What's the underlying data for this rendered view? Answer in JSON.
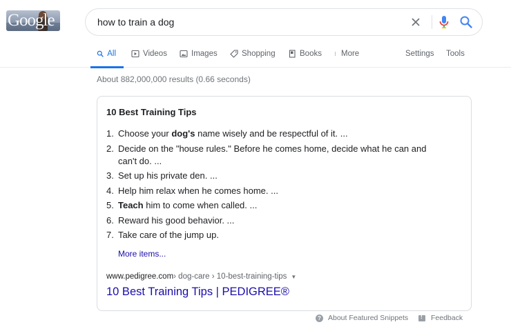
{
  "search": {
    "query": "how to train a dog"
  },
  "tabs": [
    {
      "label": "All",
      "icon": "search-icon",
      "active": true
    },
    {
      "label": "Videos",
      "icon": "play-icon"
    },
    {
      "label": "Images",
      "icon": "image-icon"
    },
    {
      "label": "Shopping",
      "icon": "tag-icon"
    },
    {
      "label": "Books",
      "icon": "book-icon"
    },
    {
      "label": "More",
      "icon": "more-vertical-icon"
    }
  ],
  "tools": {
    "settings": "Settings",
    "tools": "Tools"
  },
  "result_stats": "About 882,000,000 results (0.66 seconds)",
  "snippet": {
    "title": "10 Best Training Tips",
    "items": [
      {
        "num": "1.",
        "parts": [
          {
            "t": "Choose your "
          },
          {
            "t": "dog's",
            "b": true
          },
          {
            "t": " name wisely and be respectful of it. ..."
          }
        ]
      },
      {
        "num": "2.",
        "parts": [
          {
            "t": "Decide on the \"house rules.\" Before he comes home, decide what he can and can't do. ..."
          }
        ]
      },
      {
        "num": "3.",
        "parts": [
          {
            "t": "Set up his private den. ..."
          }
        ]
      },
      {
        "num": "4.",
        "parts": [
          {
            "t": "Help him relax when he comes home. ..."
          }
        ]
      },
      {
        "num": "5.",
        "parts": [
          {
            "t": "Teach",
            "b": true
          },
          {
            "t": " him to come when called. ..."
          }
        ]
      },
      {
        "num": "6.",
        "parts": [
          {
            "t": "Reward his good behavior. ..."
          }
        ]
      },
      {
        "num": "7.",
        "parts": [
          {
            "t": "Take care of the jump up."
          }
        ]
      }
    ],
    "more_items": "More items...",
    "cite_domain": "www.pedigree.com",
    "cite_path": " › dog-care › 10-best-training-tips",
    "link_title": "10 Best Training Tips | PEDIGREE®"
  },
  "footer": {
    "about": "About Featured Snippets",
    "feedback": "Feedback"
  },
  "logo": {
    "text": "Google"
  },
  "colors": {
    "accent": "#1a73e8",
    "link": "#1a0dab",
    "mic_blue": "#4285f4",
    "mic_red": "#ea4335"
  }
}
